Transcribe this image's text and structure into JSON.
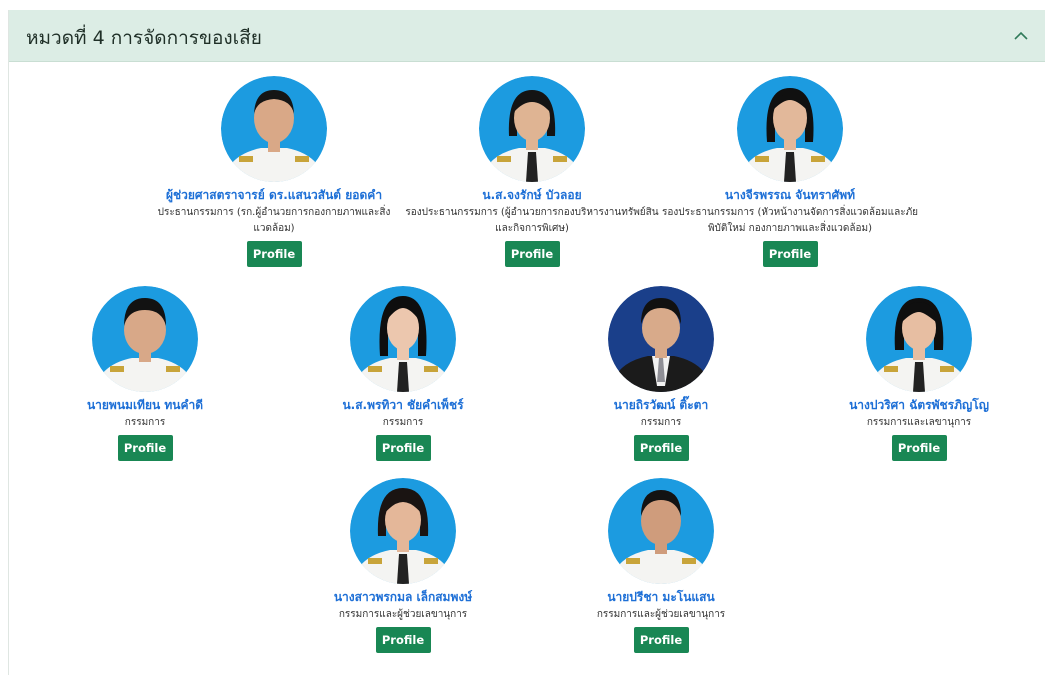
{
  "section": {
    "title": "หมวดที่ 4 การจัดการของเสีย"
  },
  "colors": {
    "header_bg": "#dcede5",
    "name": "#1d6fd6",
    "button": "#198754"
  },
  "members": [
    {
      "name": "ผู้ช่วยศาสตราจารย์ ดร.แสนวสันต์ ยอดคำ",
      "position": "ประธานกรรมการ (รก.ผู้อำนวยการกองกายภาพและสิ่งแวดล้อม)",
      "button": "Profile"
    },
    {
      "name": "น.ส.จงรักษ์ บัวลอย",
      "position": "รองประธานกรรมการ (ผู้อำนวยการกองบริหารงานทรัพย์สินและกิจการพิเศษ)",
      "button": "Profile"
    },
    {
      "name": "นางจีรพรรณ จันทราศัพท์",
      "position": "รองประธานกรรมการ (หัวหน้างานจัดการสิ่งแวดล้อมและภัยพิบัติใหม่ กองกายภาพและสิ่งแวดล้อม)",
      "button": "Profile"
    },
    {
      "name": "นายพนมเทียน ทนคำดี",
      "position": "กรรมการ",
      "button": "Profile"
    },
    {
      "name": "น.ส.พรทิวา ชัยคำเพ็ชร์",
      "position": "กรรมการ",
      "button": "Profile"
    },
    {
      "name": "นายถิรวัฒน์ ติ๊ะตา",
      "position": "กรรมการ",
      "button": "Profile"
    },
    {
      "name": "นางปวริศา ฉัตรพัชรภิญโญ",
      "position": "กรรมการและเลขานุการ",
      "button": "Profile"
    },
    {
      "name": "นางสาวพรกมล เล็กสมพงษ์",
      "position": "กรรมการและผู้ช่วยเลขานุการ",
      "button": "Profile"
    },
    {
      "name": "นายปรีชา มะโนแสน",
      "position": "กรรมการและผู้ช่วยเลขานุการ",
      "button": "Profile"
    }
  ]
}
